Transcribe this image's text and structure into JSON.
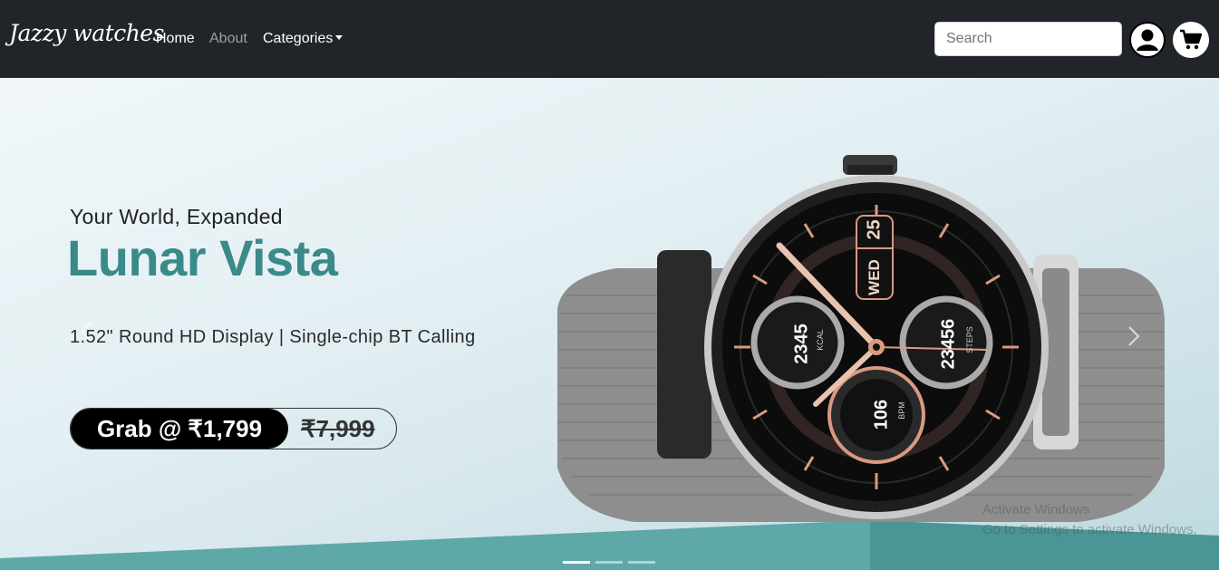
{
  "navbar": {
    "brand": "Jazzy watches",
    "links": {
      "home": "Home",
      "about": "About",
      "categories": "Categories"
    },
    "search": {
      "placeholder": "Search",
      "value": ""
    },
    "icons": {
      "account": "user-circle-icon",
      "cart": "shopping-cart-icon"
    }
  },
  "hero": {
    "tagline": "Your World, Expanded",
    "title": "Lunar Vista",
    "features": "1.52\" Round HD Display | Single-chip BT Calling",
    "cta_price": "Grab @ ₹1,799",
    "cta_old_price": "₹7,999",
    "watch_face": {
      "day": "WED",
      "date": "25",
      "kcal_value": "2345",
      "kcal_label": "KCAL",
      "steps_value": "23456",
      "steps_label": "STEPS",
      "bpm_value": "106",
      "bpm_label": "BPM"
    },
    "active_slide": 1,
    "slide_count": 3
  },
  "watermark": {
    "line1": "Activate Windows",
    "line2": "Go to Settings to activate Windows."
  },
  "colors": {
    "navbar_bg": "#212529",
    "title_teal": "#3a8a8a",
    "cta_bg": "#000000"
  }
}
